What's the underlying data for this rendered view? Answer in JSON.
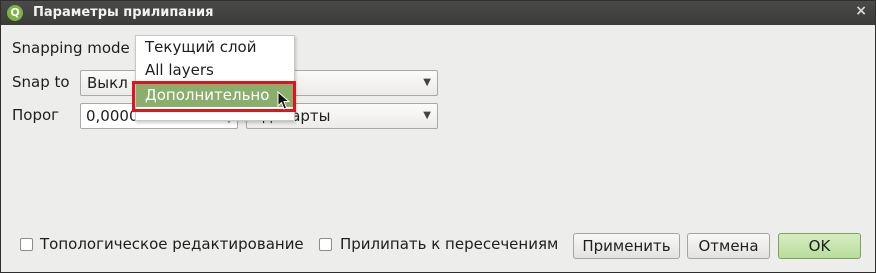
{
  "window": {
    "title": "Параметры прилипания",
    "close_glyph": "×",
    "app_icon_letter": "Q"
  },
  "form": {
    "snapping_mode_label": "Snapping mode",
    "snap_to_label": "Snap to",
    "snap_to_value": "Выкл",
    "threshold_label": "Порог",
    "threshold_value": "0,00000",
    "units_value": "ед. карты"
  },
  "dropdown": {
    "options": [
      "Текущий слой",
      "All layers",
      "Дополнительно"
    ],
    "selected_index": 2,
    "highlight_color": "#e0151b",
    "selection_color": "#8bae6d"
  },
  "footer": {
    "topological_label": "Топологическое редактирование",
    "intersections_label": "Прилипать к пересечениям",
    "apply_label": "Применить",
    "cancel_label": "Отмена",
    "ok_label": "OK"
  },
  "icons": {
    "combo_arrow": "▼",
    "spin_up": "▲",
    "spin_down": "▼"
  }
}
